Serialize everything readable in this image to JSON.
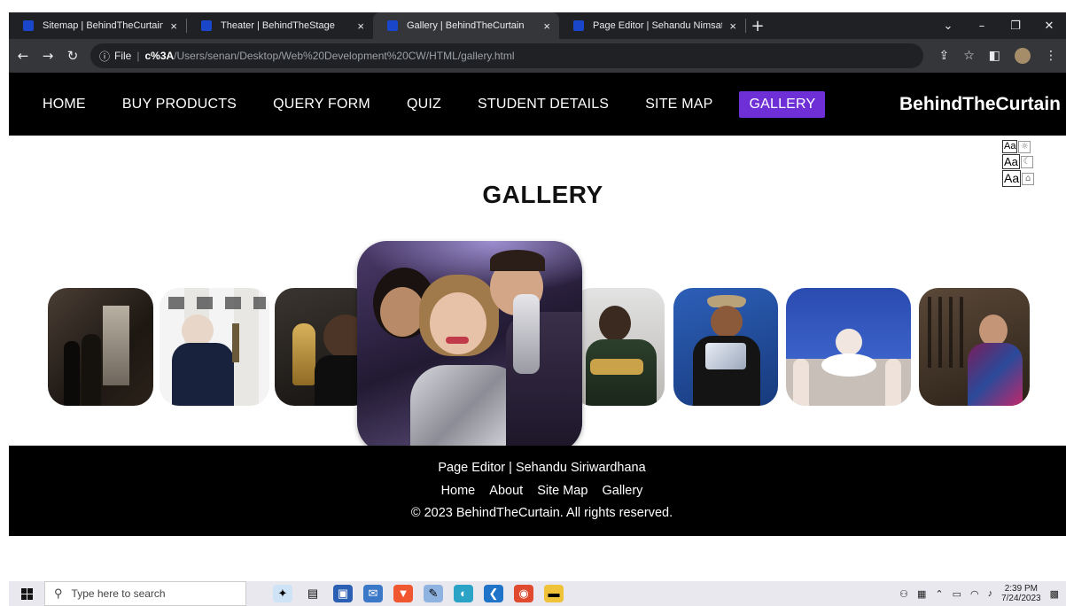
{
  "browser": {
    "tabs": [
      {
        "title": "Sitemap | BehindTheCurtain",
        "active": false
      },
      {
        "title": "Theater | BehindTheStage",
        "active": false
      },
      {
        "title": "Gallery | BehindTheCurtain",
        "active": true
      },
      {
        "title": "Page Editor | Sehandu Nimsath S",
        "active": false
      }
    ],
    "close_glyph": "×",
    "new_tab_glyph": "+",
    "address": {
      "info_glyph": "ⓘ",
      "scheme": "File",
      "separator": "|",
      "host": "c%3A",
      "path": "/Users/senan/Desktop/Web%20Development%20CW/HTML/gallery.html"
    }
  },
  "site": {
    "nav": [
      {
        "label": "HOME",
        "active": false
      },
      {
        "label": "BUY PRODUCTS",
        "active": false
      },
      {
        "label": "QUERY FORM",
        "active": false
      },
      {
        "label": "QUIZ",
        "active": false
      },
      {
        "label": "STUDENT DETAILS",
        "active": false
      },
      {
        "label": "SITE MAP",
        "active": false
      },
      {
        "label": "GALLERY",
        "active": true
      }
    ],
    "brand": "BehindTheCurtain",
    "toggles": {
      "aa": "Aa"
    },
    "title": "GALLERY",
    "gallery_icons": [
      "tony-awards-photo",
      "olivier-awards-photo",
      "emmy-photo",
      "vma-photo-featured",
      "grammy-photo",
      "cma-awards-photo",
      "prix-de-lausanne-photo",
      "sculpture-award-photo"
    ],
    "footer": {
      "editor": "Page Editor | Sehandu Siriwardhana",
      "links": [
        "Home",
        "About",
        "Site Map",
        "Gallery"
      ],
      "copyright": "© 2023 BehindTheCurtain. All rights reserved."
    }
  },
  "taskbar": {
    "search_placeholder": "Type here to search",
    "time": "2:39 PM",
    "date": "7/24/2023"
  },
  "colors": {
    "nav_active": "#6f2fd6",
    "tab_fav": "#1a47c9"
  }
}
